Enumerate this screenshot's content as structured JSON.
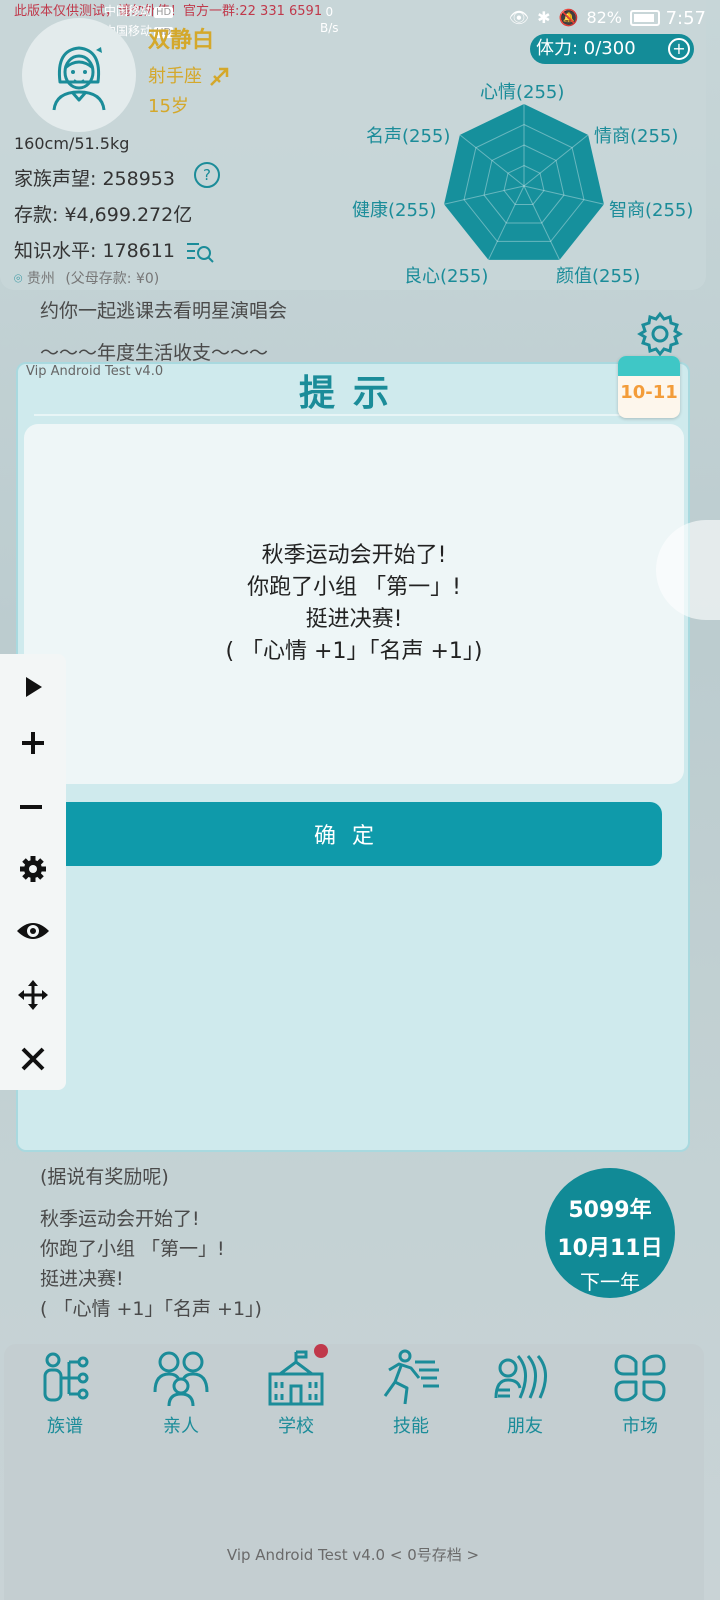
{
  "status_bar": {
    "watermark": "此版本仅供测试，请勿外传！官方一群:22 331 6591",
    "carrier1": "中国移动",
    "carrier2": "中国移动",
    "hd": "HD",
    "net_speed_value": "0",
    "net_speed_unit": "B/s",
    "battery": "82%",
    "time": "7:57"
  },
  "profile": {
    "name": "双静白",
    "zodiac": "射手座",
    "age": "15岁",
    "height_weight": "160cm/51.5kg",
    "family_fame": "家族声望: 258953",
    "savings": "存款: ¥4,699.272亿",
    "knowledge": "知识水平: 178611",
    "location": "贵州",
    "parent_savings": "(父母存款: ¥0)",
    "stamina": "体力: 0/300"
  },
  "radar": {
    "labels": [
      "心情(255)",
      "情商(255)",
      "智商(255)",
      "颜值(255)",
      "良心(255)",
      "健康(255)",
      "名声(255)"
    ],
    "values": [
      255,
      255,
      255,
      255,
      255,
      255,
      255
    ],
    "max": 255
  },
  "background": {
    "event_line": "约你一起逃课去看明星演唱会",
    "section_title": "～～～年度生活收支～～～",
    "reward_note": "(据说有奖励呢)",
    "log_lines": [
      "秋季运动会开始了!",
      "你跑了小组 「第一」!",
      "挺进决赛!",
      "( 「心情 +1」「名声 +1」)"
    ]
  },
  "dialog": {
    "version": "Vip Android Test v4.0",
    "title": "提示",
    "message_lines": [
      "秋季运动会开始了!",
      "你跑了小组 「第一」!",
      "挺进决赛!",
      "( 「心情 +1」「名声 +1」)"
    ],
    "confirm_label": "确定",
    "date_badge": "10-11"
  },
  "year_circle": {
    "year": "5099年",
    "date": "10月11日",
    "next": "下一年"
  },
  "nav": {
    "items": [
      {
        "label": "族谱",
        "icon": "family-tree-icon"
      },
      {
        "label": "亲人",
        "icon": "relatives-icon"
      },
      {
        "label": "学校",
        "icon": "school-icon"
      },
      {
        "label": "技能",
        "icon": "skills-icon"
      },
      {
        "label": "朋友",
        "icon": "friends-icon"
      },
      {
        "label": "市场",
        "icon": "market-icon"
      }
    ]
  },
  "footer": "Vip Android Test v4.0  < 0号存档 >",
  "colors": {
    "accent": "#1b8c99",
    "button": "#0f9aaa",
    "gold": "#d4a82b",
    "badge_red": "#c0394b"
  }
}
